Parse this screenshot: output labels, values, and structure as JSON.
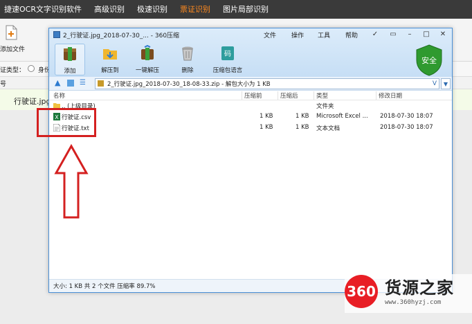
{
  "bg_app": {
    "title": "捷速OCR文字识别软件",
    "nav": [
      "高级识别",
      "极速识别",
      "票证识别",
      "图片局部识别"
    ],
    "active_nav_index": 2,
    "add_file_label": "添加文件",
    "type_label": "证类型：",
    "radio_label": "身份",
    "row2_label": "号",
    "file_item": "行驶证.jpg"
  },
  "archive_window": {
    "title": "2_行驶证.jpg_2018-07-30_... - 360压缩",
    "menu": [
      "文件",
      "操作",
      "工具",
      "帮助"
    ],
    "window_buttons": [
      "✓",
      "▭",
      "–",
      "□",
      "✕"
    ],
    "tools": [
      "添加",
      "解压到",
      "一键解压",
      "删除",
      "压缩包语言"
    ],
    "shield_label": "安全",
    "address": "2_行驶证.jpg_2018-07-30_18-08-33.zip - 解包大小为 1 KB",
    "columns": [
      "名称",
      "压缩前",
      "压缩后",
      "类型",
      "修改日期"
    ],
    "files": [
      {
        "name": ".. (上级目录)",
        "before": "",
        "after": "",
        "type": "文件夹",
        "date": "",
        "icon": "folder-icon"
      },
      {
        "name": "行驶证.csv",
        "before": "1 KB",
        "after": "1 KB",
        "type": "Microsoft Excel ...",
        "date": "2018-07-30 18:07",
        "icon": "excel-icon"
      },
      {
        "name": "行驶证.txt",
        "before": "1 KB",
        "after": "1 KB",
        "type": "文本文档",
        "date": "2018-07-30 18:07",
        "icon": "text-file-icon"
      }
    ],
    "status": "大小: 1 KB 共 2 个文件 压缩率 89.7%"
  },
  "watermark": {
    "logo": "360",
    "name": "货源之家",
    "url": "www.360hyzj.com"
  },
  "colors": {
    "active_nav": "#ff8a1f",
    "annotation_red": "#d42020",
    "window_border": "#4a8fd6",
    "shield_green": "#2f9a2f"
  }
}
